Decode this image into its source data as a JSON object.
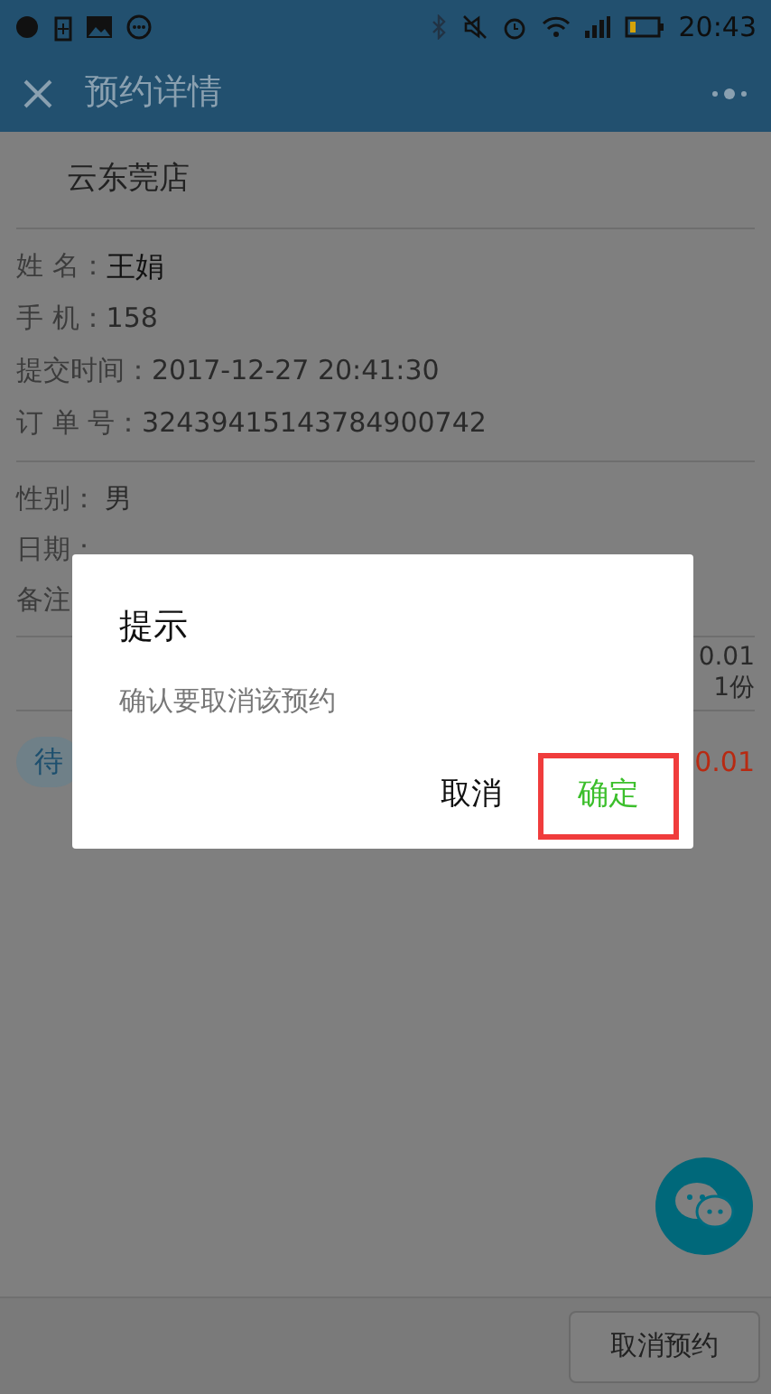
{
  "status_bar": {
    "time": "20:43"
  },
  "header": {
    "title": "预约详情"
  },
  "store": {
    "name": "云东莞店"
  },
  "info": [
    {
      "label": "姓 名：",
      "value": "王娟",
      "kind": "strong"
    },
    {
      "label": "手 机：",
      "value": "158",
      "kind": "plain"
    },
    {
      "label": "提交时间：",
      "value": "2017-12-27 20:41:30",
      "kind": "plain"
    },
    {
      "label": "订 单 号：",
      "value": "32439415143784900742",
      "kind": "plain"
    }
  ],
  "details": [
    {
      "label": "性别：",
      "value": "男"
    },
    {
      "label": "日期："
    },
    {
      "label": "备注"
    }
  ],
  "price": {
    "unit": "0.01",
    "quantity": "1份"
  },
  "order": {
    "status": "待",
    "total": "0.01"
  },
  "dialog": {
    "title": "提示",
    "message": "确认要取消该预约",
    "buttons": [
      {
        "label": "取消",
        "highlighted": false
      },
      {
        "label": "确定",
        "highlighted": true
      }
    ]
  },
  "bottom": {
    "button": "取消预约"
  }
}
